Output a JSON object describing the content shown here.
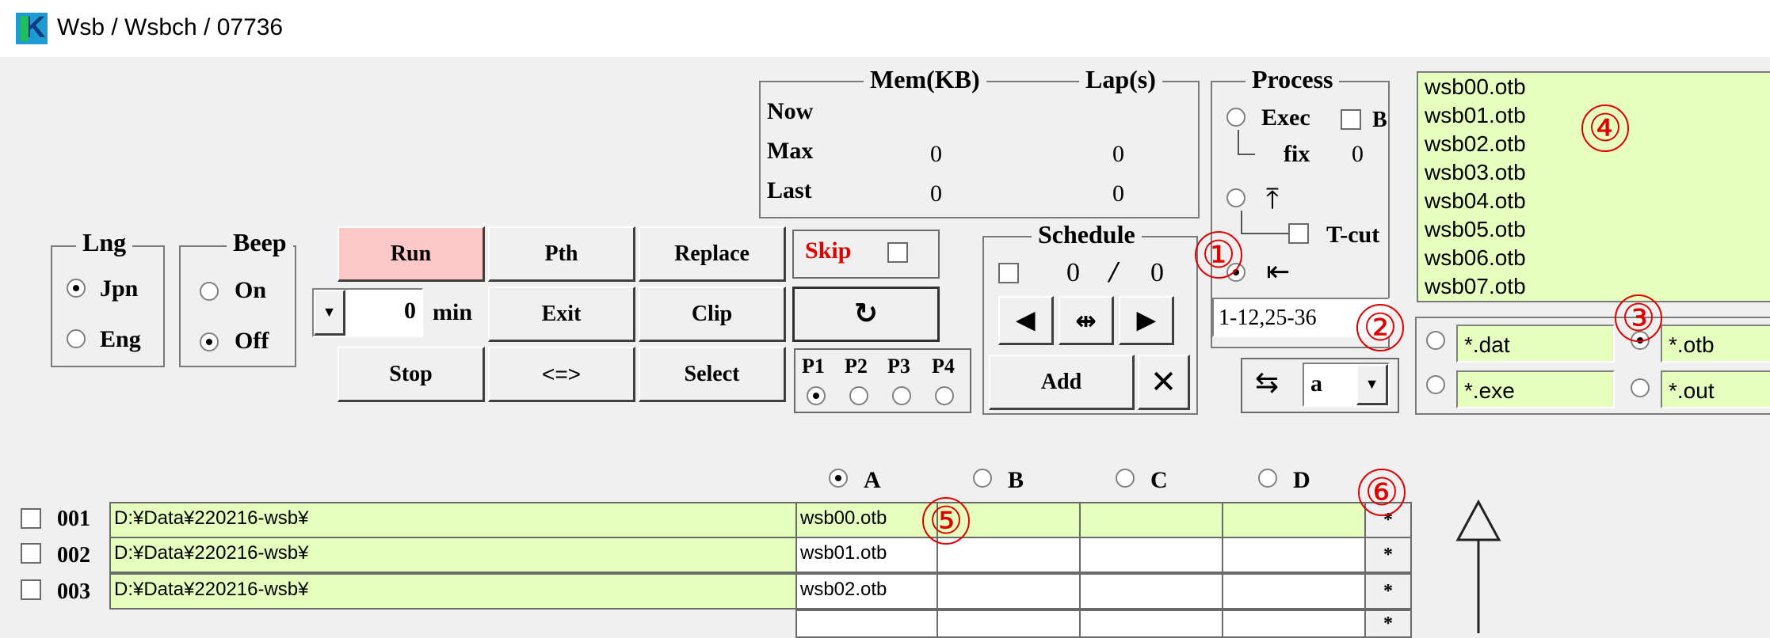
{
  "window": {
    "title": "Wsb / Wsbch / 07736"
  },
  "stats": {
    "mem_legend": "Mem(KB)",
    "lap_legend": "Lap(s)",
    "rows": [
      {
        "label": "Now",
        "mem": "",
        "lap": ""
      },
      {
        "label": "Max",
        "mem": "0",
        "lap": "0"
      },
      {
        "label": "Last",
        "mem": "0",
        "lap": "0"
      }
    ]
  },
  "process": {
    "legend": "Process",
    "exec_label": "Exec",
    "b_label": "B",
    "fix_label": "fix",
    "fix_value": "0",
    "tcut_label": "T-cut",
    "range_value": "1-12,25-36"
  },
  "lng": {
    "legend": "Lng",
    "jpn": "Jpn",
    "eng": "Eng"
  },
  "beep": {
    "legend": "Beep",
    "on": "On",
    "off": "Off"
  },
  "buttons": {
    "run": "Run",
    "pth": "Pth",
    "replace": "Replace",
    "skip": "Skip",
    "exit": "Exit",
    "clip": "Clip",
    "stop": "Stop",
    "swap": "<=>",
    "select": "Select",
    "add": "Add"
  },
  "timer": {
    "value": "0",
    "unit": "min"
  },
  "priority": {
    "labels": [
      "P1",
      "P2",
      "P3",
      "P4"
    ]
  },
  "schedule": {
    "legend": "Schedule",
    "count_a": "0",
    "separator": "/",
    "count_b": "0"
  },
  "sort": {
    "value": "a"
  },
  "file_list": {
    "items": [
      "wsb00.otb",
      "wsb01.otb",
      "wsb02.otb",
      "wsb03.otb",
      "wsb04.otb",
      "wsb05.otb",
      "wsb06.otb",
      "wsb07.otb"
    ]
  },
  "filters": {
    "dat": "*.dat",
    "exe": "*.exe",
    "otb": "*.otb",
    "out": "*.out"
  },
  "columns": {
    "a": "A",
    "b": "B",
    "c": "C",
    "d": "D"
  },
  "table": {
    "rows": [
      {
        "num": "001",
        "path": "D:¥Data¥220216-wsb¥",
        "file": "wsb00.otb"
      },
      {
        "num": "002",
        "path": "D:¥Data¥220216-wsb¥",
        "file": "wsb01.otb"
      },
      {
        "num": "003",
        "path": "D:¥Data¥220216-wsb¥",
        "file": "wsb02.otb"
      }
    ],
    "star": "*"
  },
  "annotations": {
    "a1": "①",
    "a2": "②",
    "a3": "③",
    "a4": "④",
    "a5": "⑤",
    "a6": "⑥"
  },
  "colors": {
    "run_bg": "#ffc8c8",
    "field_green": "#e6ffbf",
    "annotation": "#e00000",
    "skip_text": "#e00000"
  }
}
